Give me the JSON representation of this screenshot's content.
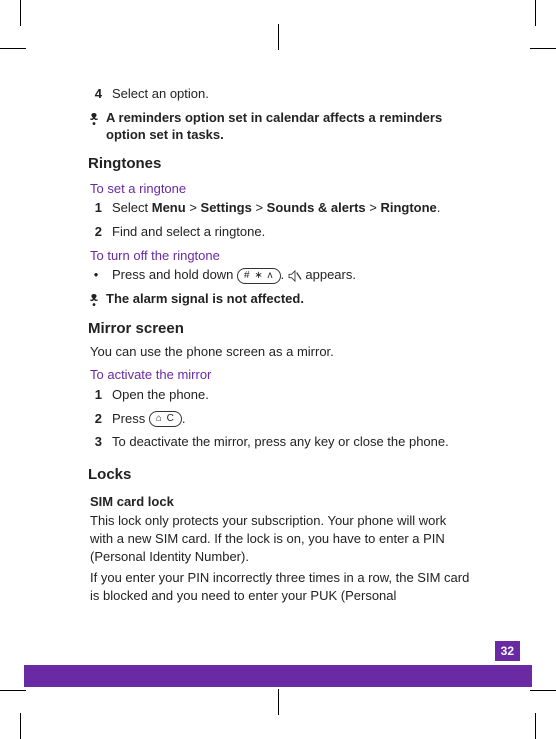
{
  "steps_prev": {
    "num": "4",
    "text": "Select an option."
  },
  "note_reminders": "A reminders option set in calendar affects a reminders option set in tasks.",
  "ringtones": {
    "heading": "Ringtones",
    "set": {
      "title": "To set a ringtone",
      "step1_num": "1",
      "step1_pre": "Select ",
      "menu": "Menu",
      "gt1": " > ",
      "settings": "Settings",
      "gt2": " > ",
      "sounds": "Sounds & alerts",
      "gt3": " > ",
      "ringtone": "Ringtone",
      "period": ".",
      "step2_num": "2",
      "step2_text": "Find and select a ringtone."
    },
    "off": {
      "title": "To turn off the ringtone",
      "bullet": "•",
      "pre": "Press and hold down ",
      "key_label": "# ∗ ʌ",
      "period1": ".  ",
      "post": " appears."
    },
    "note_alarm": "The alarm signal is not affected."
  },
  "mirror": {
    "heading": "Mirror screen",
    "desc": "You can use the phone screen as a mirror.",
    "activate": {
      "title": "To activate the mirror",
      "s1_num": "1",
      "s1_text": "Open the phone.",
      "s2_num": "2",
      "s2_pre": "Press ",
      "s2_key": "⌂ C",
      "s2_period": ".",
      "s3_num": "3",
      "s3_text": "To deactivate the mirror, press any key or close the phone."
    }
  },
  "locks": {
    "heading": "Locks",
    "sim": {
      "title": "SIM card lock",
      "p1": "This lock only protects your subscription. Your phone will work with a new SIM card. If the lock is on, you have to enter a PIN (Personal Identity Number).",
      "p2": "If you enter your PIN incorrectly three times in a row, the SIM card is blocked and you need to enter your PUK (Personal"
    }
  },
  "page_number": "32"
}
